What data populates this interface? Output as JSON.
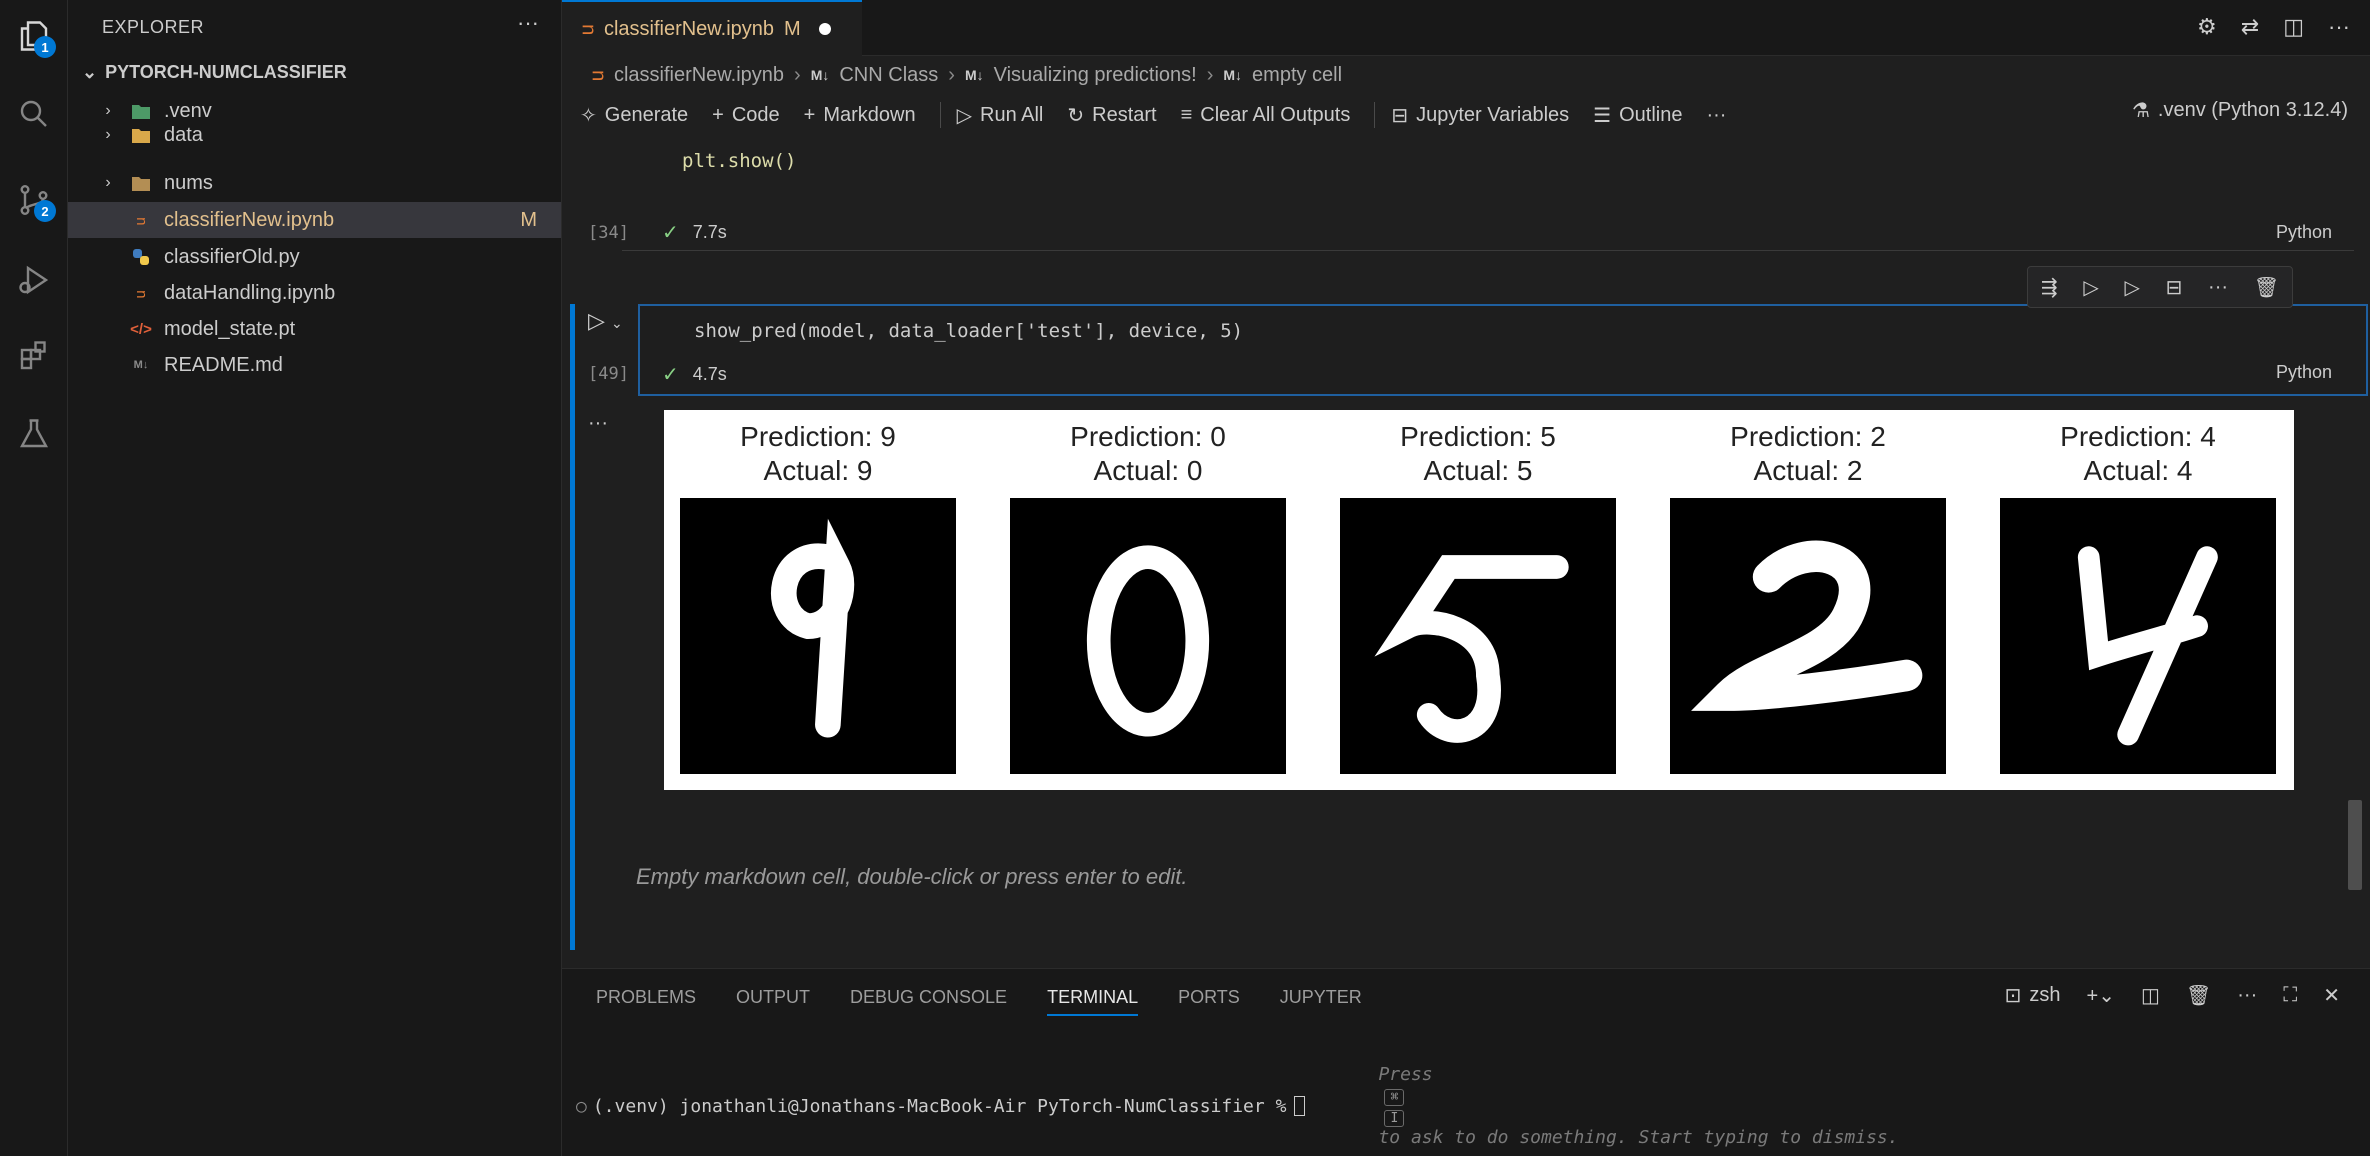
{
  "activity": {
    "explorer_badge": "1",
    "scm_badge": "2"
  },
  "sidebar": {
    "title": "EXPLORER",
    "more": "···",
    "project": "PYTORCH-NUMCLASSIFIER",
    "items": [
      {
        "name": ".venv",
        "type": "folder"
      },
      {
        "name": "data",
        "type": "folder"
      },
      {
        "name": "nums",
        "type": "folder"
      },
      {
        "name": "classifierNew.ipynb",
        "type": "notebook",
        "badge": "M"
      },
      {
        "name": "classifierOld.py",
        "type": "python"
      },
      {
        "name": "dataHandling.ipynb",
        "type": "notebook"
      },
      {
        "name": "model_state.pt",
        "type": "pt"
      },
      {
        "name": "README.md",
        "type": "md"
      }
    ]
  },
  "tab": {
    "label": "classifierNew.ipynb",
    "badge": "M"
  },
  "breadcrumb": {
    "file": "classifierNew.ipynb",
    "mk": "M↓",
    "items": [
      "CNN Class",
      "Visualizing predictions!",
      "empty cell"
    ]
  },
  "toolbar": {
    "generate": "Generate",
    "code": "Code",
    "markdown": "Markdown",
    "run_all": "Run All",
    "restart": "Restart",
    "clear_outputs": "Clear All Outputs",
    "variables": "Jupyter Variables",
    "outline": "Outline",
    "more": "···",
    "kernel": ".venv (Python 3.12.4)"
  },
  "cells": {
    "prev": {
      "code": "plt.show()",
      "count": "[34]",
      "time": "7.7s",
      "lang": "Python"
    },
    "current": {
      "code": "show_pred(model, data_loader['test'], device, 5)",
      "count": "[49]",
      "time": "4.7s",
      "lang": "Python"
    },
    "output_more": "···",
    "predictions": [
      {
        "prediction": "Prediction: 9",
        "actual": "Actual: 9"
      },
      {
        "prediction": "Prediction: 0",
        "actual": "Actual: 0"
      },
      {
        "prediction": "Prediction: 5",
        "actual": "Actual: 5"
      },
      {
        "prediction": "Prediction: 2",
        "actual": "Actual: 2"
      },
      {
        "prediction": "Prediction: 4",
        "actual": "Actual: 4"
      }
    ],
    "empty_markdown": "Empty markdown cell, double-click or press enter to edit."
  },
  "panel": {
    "tabs": [
      "PROBLEMS",
      "OUTPUT",
      "DEBUG CONSOLE",
      "TERMINAL",
      "PORTS",
      "JUPYTER"
    ],
    "shell": "zsh",
    "prompt": "(.venv) jonathanli@Jonathans-MacBook-Air PyTorch-NumClassifier %",
    "hint_pre": "Press",
    "hint_k1": "⌘",
    "hint_k2": "I",
    "hint_post": "to ask to do something. Start typing to dismiss."
  }
}
